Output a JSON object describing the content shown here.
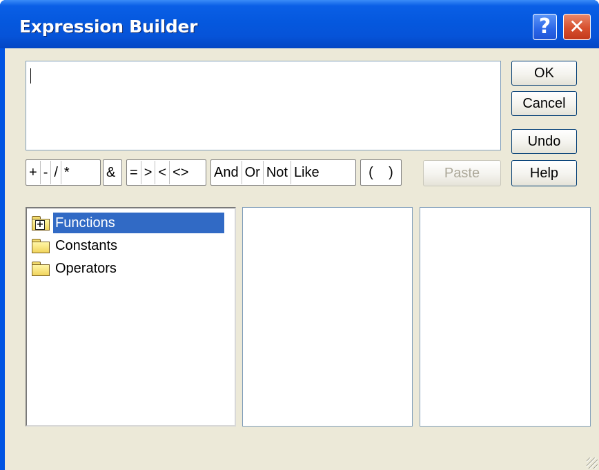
{
  "window": {
    "title": "Expression Builder",
    "help_label": "?",
    "close_label": "✕"
  },
  "expression": {
    "value": ""
  },
  "buttons": {
    "ok": "OK",
    "cancel": "Cancel",
    "undo": "Undo",
    "help": "Help",
    "paste": "Paste"
  },
  "operators": {
    "arith": [
      "+",
      "-",
      "/",
      "*"
    ],
    "concat": [
      "&"
    ],
    "compare": [
      "=",
      ">",
      "<",
      "<>"
    ],
    "logical": [
      "And",
      "Or",
      "Not",
      "Like"
    ],
    "paren": [
      "(",
      ")"
    ]
  },
  "tree": {
    "items": [
      {
        "label": "Functions",
        "icon": "folder-plus-icon",
        "selected": true
      },
      {
        "label": "Constants",
        "icon": "folder-icon",
        "selected": false
      },
      {
        "label": "Operators",
        "icon": "folder-icon",
        "selected": false
      }
    ]
  },
  "colors": {
    "titlebar": "#0558de",
    "selection": "#316ac5",
    "dialog_bg": "#ece9d8"
  }
}
